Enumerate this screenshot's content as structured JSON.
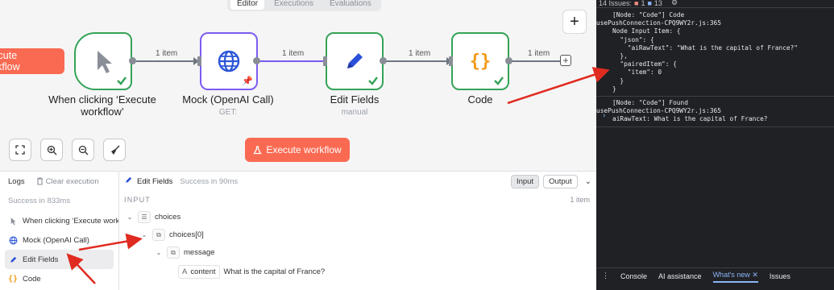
{
  "canvas": {
    "tabs": [
      "Editor",
      "Executions",
      "Evaluations"
    ],
    "exec_left_label": "Execute workflow",
    "add_node_symbol": "+",
    "nodes": [
      {
        "label": "When clicking ‘Execute workflow’",
        "sub": "",
        "icon": "pointer-icon"
      },
      {
        "label": "Mock (OpenAI Call)",
        "sub": "GET:",
        "icon": "globe-icon"
      },
      {
        "label": "Edit Fields",
        "sub": "manual",
        "icon": "pencil-icon"
      },
      {
        "label": "Code",
        "sub": "",
        "icon": "braces-icon"
      }
    ],
    "edges": [
      "1 item",
      "1 item",
      "1 item",
      "1 item"
    ],
    "execute_button": "Execute workflow"
  },
  "logs": {
    "title": "Logs",
    "clear_label": "Clear execution",
    "status": "Success in 833ms",
    "items": [
      {
        "label": "When clicking ‘Execute workflow’",
        "icon": "pointer-icon"
      },
      {
        "label": "Mock (OpenAI Call)",
        "icon": "globe-icon"
      },
      {
        "label": "Edit Fields",
        "icon": "pencil-icon"
      },
      {
        "label": "Code",
        "icon": "braces-icon"
      }
    ]
  },
  "detail": {
    "node_name": "Edit Fields",
    "status": "Success in 90ms",
    "input_tab": "Input",
    "output_tab": "Output",
    "section_label": "INPUT",
    "items_count": "1 item",
    "tree": {
      "choices": "choices",
      "choices0": "choices[0]",
      "message": "message",
      "content_key": "content",
      "content_value": "What is the capital of France?",
      "content_type": "A"
    }
  },
  "devtools": {
    "issues_label": "14 Issues:",
    "error_count": "1",
    "info_count": "13",
    "log1_lines": [
      "[Node: \"Code\"] Code",
      "Node Input Item: {",
      "  \"json\": {",
      "    \"aiRawText\": \"What is the capital of France?\"",
      "  },",
      "  \"pairedItem\": {",
      "    \"item\": 0",
      "  }",
      "}"
    ],
    "log1_source": "usePushConnection-CPQ9WY2r.js:365",
    "log2_lines": [
      "[Node: \"Code\"] Found",
      "aiRawText: What is the capital of France?"
    ],
    "log2_source": "usePushConnection-CPQ9WY2r.js:365",
    "prompt": "›",
    "bottom_tabs": [
      "Console",
      "AI assistance",
      "What's new",
      "Issues"
    ],
    "accent": "#8ab4f8"
  },
  "colors": {
    "node_success_border": "#35a357",
    "node_selected_border": "#7b5cf0",
    "execute_button": "#fa6a52",
    "annotation_arrow": "#e02b20"
  }
}
